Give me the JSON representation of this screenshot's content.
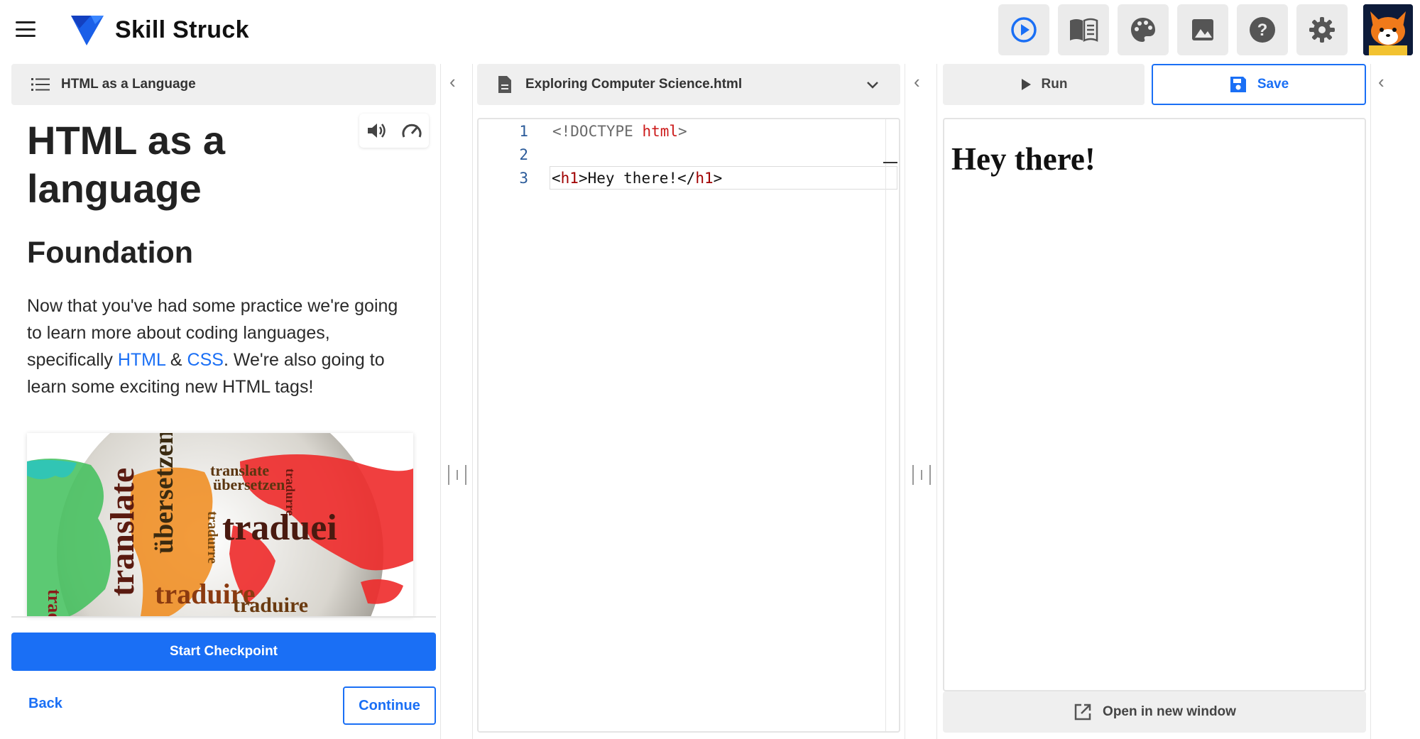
{
  "header": {
    "brand": "Skill Struck",
    "tools": [
      {
        "icon": "play-circle-icon"
      },
      {
        "icon": "book-icon"
      },
      {
        "icon": "palette-icon"
      },
      {
        "icon": "image-icon"
      },
      {
        "icon": "help-icon"
      },
      {
        "icon": "settings-icon"
      }
    ],
    "accent": "#1a6ff5"
  },
  "lesson": {
    "tab_label": "HTML as a Language",
    "title": "HTML as a language",
    "subtitle": "Foundation",
    "para_part1": "Now that you've had some practice we're going to learn more about coding languages, specifically ",
    "link_html": "HTML",
    "amp": " & ",
    "link_css": "CSS",
    "para_part2": ". We're also going to learn some exciting new HTML tags!",
    "start_checkpoint": "Start Checkpoint",
    "back": "Back",
    "continue": "Continue"
  },
  "editor": {
    "file_name": "Exploring Computer Science.html",
    "lines": [
      {
        "num": "1",
        "p1": "<!DOCTYPE ",
        "p2": "html",
        "p3": ">"
      },
      {
        "num": "2"
      },
      {
        "num": "3",
        "a": "<",
        "b": "h1",
        "c": ">Hey there!</",
        "d": "h1",
        "e": ">"
      }
    ]
  },
  "preview": {
    "run": "Run",
    "save": "Save",
    "heading": "Hey there!",
    "open_new_window": "Open in new window"
  }
}
